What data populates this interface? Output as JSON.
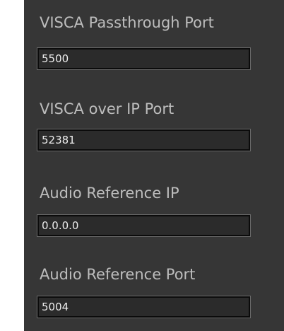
{
  "fields": [
    {
      "label": "VISCA Passthrough Port",
      "value": "5500"
    },
    {
      "label": "VISCA over IP Port",
      "value": "52381"
    },
    {
      "label": "Audio Reference IP",
      "value": "0.0.0.0"
    },
    {
      "label": "Audio Reference Port",
      "value": "5004"
    }
  ],
  "colors": {
    "panel_background": "#363636",
    "label_text": "#bdbdbd",
    "input_background": "#2b2b2b",
    "input_text": "#ededed"
  }
}
